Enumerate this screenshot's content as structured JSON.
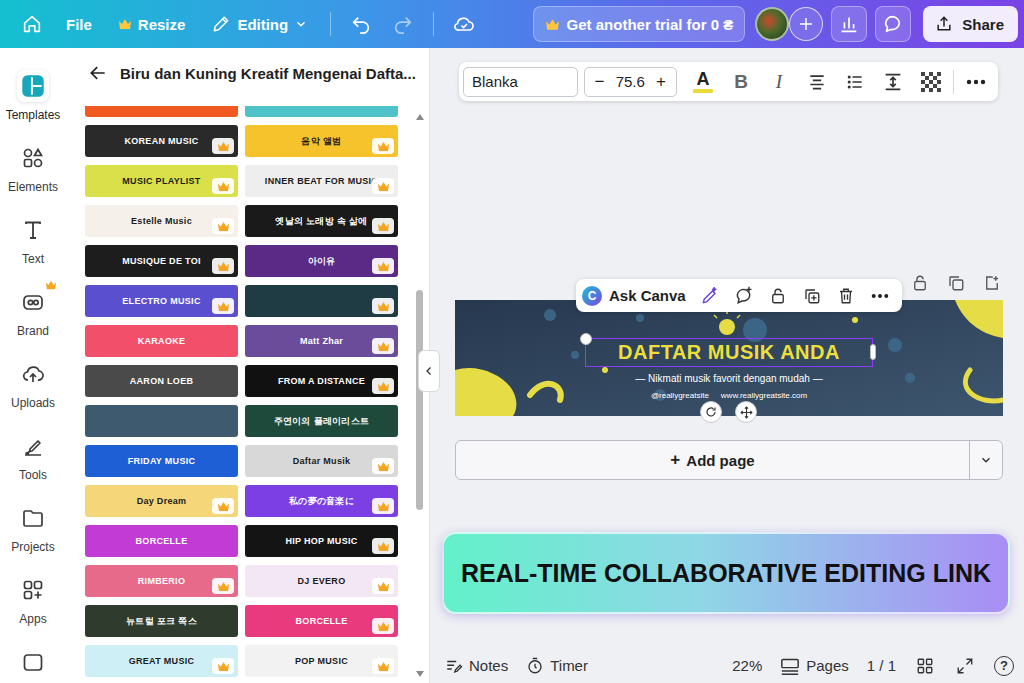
{
  "topbar": {
    "file": "File",
    "resize": {
      "label": "Resize",
      "premium": true
    },
    "editing": "Editing",
    "trial": {
      "label": "Get another trial for 0 ₴",
      "premium": true
    },
    "share": "Share"
  },
  "rail": [
    {
      "label": "Templates",
      "selected": true,
      "premium": false
    },
    {
      "label": "Elements",
      "selected": false,
      "premium": false
    },
    {
      "label": "Text",
      "selected": false,
      "premium": false
    },
    {
      "label": "Brand",
      "selected": false,
      "premium": true
    },
    {
      "label": "Uploads",
      "selected": false,
      "premium": false
    },
    {
      "label": "Tools",
      "selected": false,
      "premium": false
    },
    {
      "label": "Projects",
      "selected": false,
      "premium": false
    },
    {
      "label": "Apps",
      "selected": false,
      "premium": false
    }
  ],
  "panel": {
    "title": "Biru dan Kuning Kreatif Mengenai Dafta...",
    "templates": [
      {
        "color": "#f0591f",
        "premium": false
      },
      {
        "color": "#4fc2c9",
        "premium": false
      },
      {
        "text": "KOREAN MUSIC",
        "color": "#2a2a2a",
        "premium": true
      },
      {
        "text": "음악 앨범",
        "color": "#f6c32c",
        "premium": true
      },
      {
        "text": "MUSIC PLAYLIST",
        "color": "#d9e04a",
        "premium": true
      },
      {
        "text": "INNER BEAT FOR MUSIC",
        "color": "#eeeeee",
        "premium": true
      },
      {
        "text": "Estelle Music",
        "color": "#f5f0ea",
        "premium": true
      },
      {
        "text": "옛날의 노래방 속 삶에",
        "color": "#1a1a1a",
        "premium": true
      },
      {
        "text": "MUSIQUE DE TOI",
        "color": "#1d1d1d",
        "premium": true
      },
      {
        "text": "아이유",
        "color": "#5b2a86",
        "premium": true
      },
      {
        "text": "ELECTRO MUSIC",
        "color": "#5a4fcf",
        "premium": true
      },
      {
        "color": "#1f3b44",
        "premium": true
      },
      {
        "text": "KARAOKE",
        "color": "#f2506a",
        "premium": false
      },
      {
        "text": "Matt Zhar",
        "color": "#6b4c9a",
        "premium": true
      },
      {
        "text": "AARON LOEB",
        "color": "#4a4a4a",
        "premium": false
      },
      {
        "text": "FROM A DISTANCE",
        "color": "#111111",
        "premium": true
      },
      {
        "color": "#3d5a6e",
        "premium": false
      },
      {
        "text": "주연이의 플레이리스트",
        "color": "#1e4a3c",
        "premium": false
      },
      {
        "text": "FRIDAY MUSIC",
        "color": "#1e5fd6",
        "premium": false
      },
      {
        "text": "Daftar Musik",
        "color": "#d8d8d8",
        "premium": true
      },
      {
        "text": "Day Dream",
        "color": "#f5d77a",
        "premium": true
      },
      {
        "text": "私の夢の音楽に",
        "color": "#7b3fe4",
        "premium": true
      },
      {
        "text": "BORCELLE",
        "color": "#c23bd4",
        "premium": false
      },
      {
        "text": "HIP HOP MUSIC",
        "color": "#141414",
        "premium": true
      },
      {
        "text": "RIMBERIO",
        "color": "#e86a8a",
        "premium": true
      },
      {
        "text": "DJ EVERO",
        "color": "#f3e6f5",
        "premium": true
      },
      {
        "text": "뉴트럴 포크 쪽스",
        "color": "#2f3b2c",
        "premium": false
      },
      {
        "text": "BORCELLE",
        "color": "#e93a7d",
        "premium": true
      },
      {
        "text": "GREAT MUSIC",
        "color": "#cdeff5",
        "premium": true
      },
      {
        "text": "POP MUSIC",
        "color": "#f2f2f2",
        "premium": true
      }
    ]
  },
  "text_toolbar": {
    "font": "Blanka",
    "minus": "−",
    "size": "75.6",
    "plus": "+",
    "color_letter": "A",
    "bold": "B",
    "italic": "I"
  },
  "context_toolbar": {
    "logo": "C",
    "ask": "Ask Canva"
  },
  "design": {
    "title": "DAFTAR MUSIK ANDA",
    "tagline": "— Nikmati musik favorit dengan mudah —",
    "handle": "@reallygreatsite",
    "site": "www.reallygreatsite.com",
    "selected": true
  },
  "add_page": {
    "icon": "+",
    "label": "Add page"
  },
  "banner": "REAL-TIME COLLABORATIVE EDITING LINK",
  "bottom_bar": {
    "notes": "Notes",
    "timer": "Timer",
    "zoom": "22%",
    "pages": "Pages",
    "page_count": "1 / 1",
    "help": "?"
  }
}
